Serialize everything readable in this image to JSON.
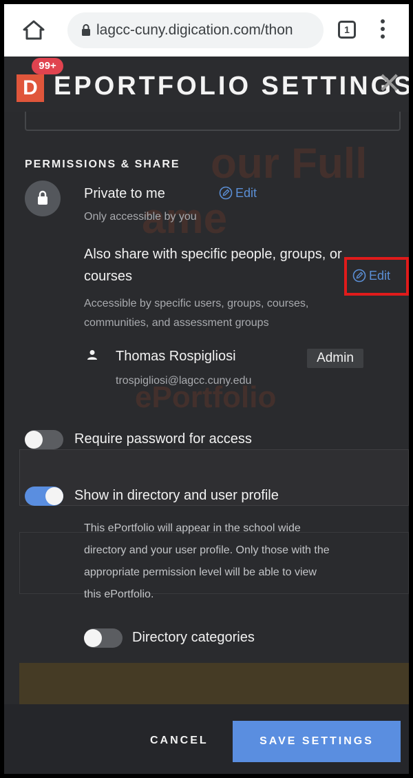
{
  "browser": {
    "url": "lagcc-cuny.digication.com/thon",
    "tab_count": "1"
  },
  "header": {
    "logo_letter": "D",
    "notification_badge": "99+",
    "title": "EPORTFOLIO SETTINGS",
    "close_symbol": "✕"
  },
  "permissions": {
    "section_title": "PERMISSIONS & SHARE",
    "private": {
      "label": "Private to me",
      "description": "Only accessible by you",
      "edit_label": "Edit"
    },
    "share": {
      "label_line1": "Also share with specific people, groups, or",
      "label_line2": "courses",
      "description_line1": "Accessible by specific users, groups, courses,",
      "description_line2": "communities, and assessment groups",
      "edit_label": "Edit"
    },
    "member": {
      "name": "Thomas Rospigliosi",
      "email": "trospigliosi@lagcc.cuny.edu",
      "role": "Admin"
    }
  },
  "options": {
    "require_password": {
      "label": "Require password for access",
      "enabled": false
    },
    "show_in_directory": {
      "label": "Show in directory and user profile",
      "enabled": true,
      "description_lines": [
        "This ePortfolio will appear in the school wide",
        "directory and your user profile. Only those with the",
        "appropriate permission level will be able to view",
        "this ePortfolio."
      ]
    },
    "directory_categories": {
      "label": "Directory categories",
      "enabled": false
    }
  },
  "footer": {
    "cancel_label": "CANCEL",
    "save_label": "SAVE SETTINGS"
  },
  "colors": {
    "accent": "#5a8ee0",
    "modal_bg": "#2a2b2e",
    "highlight_box": "#e01b1b",
    "logo": "#e0563b"
  }
}
